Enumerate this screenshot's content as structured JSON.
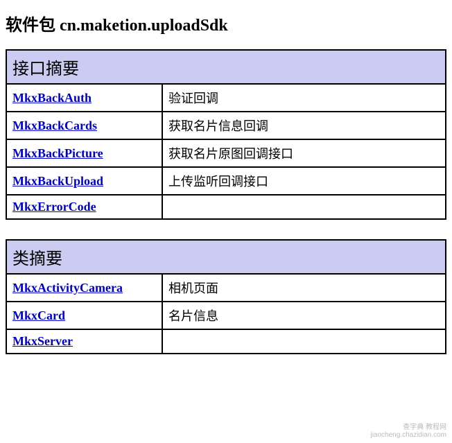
{
  "page": {
    "title_prefix": "软件包 ",
    "title_package": "cn.maketion.uploadSdk"
  },
  "interface_table": {
    "header": "接口摘要",
    "rows": [
      {
        "name": "MkxBackAuth",
        "desc": "验证回调"
      },
      {
        "name": "MkxBackCards",
        "desc": "获取名片信息回调"
      },
      {
        "name": "MkxBackPicture",
        "desc": "获取名片原图回调接口"
      },
      {
        "name": "MkxBackUpload",
        "desc": "上传监听回调接口"
      },
      {
        "name": "MkxErrorCode",
        "desc": ""
      }
    ]
  },
  "class_table": {
    "header": "类摘要",
    "rows": [
      {
        "name": "MkxActivityCamera",
        "desc": "相机页面"
      },
      {
        "name": "MkxCard",
        "desc": "名片信息"
      },
      {
        "name": "MkxServer",
        "desc": ""
      }
    ]
  },
  "watermark": {
    "line1": "查字典 教程网",
    "line2": "jiaocheng.chazidian.com"
  }
}
